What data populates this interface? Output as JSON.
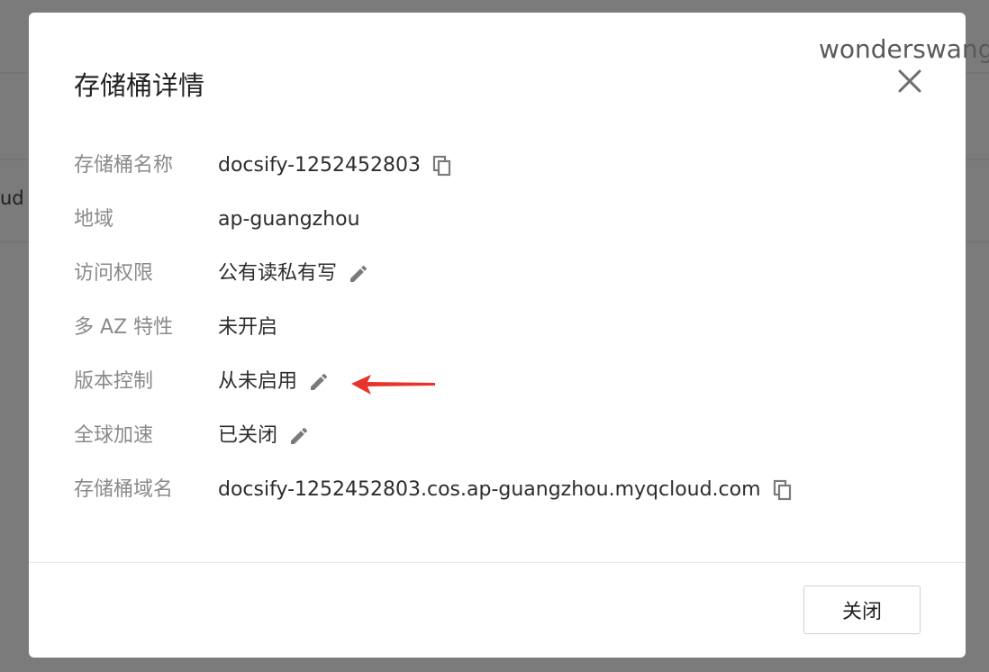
{
  "background": {
    "partial_text": "ud"
  },
  "watermark": "wonderswang",
  "dialog": {
    "title": "存储桶详情",
    "close_label": "关闭",
    "rows": [
      {
        "label": "存储桶名称",
        "value": "docsify-1252452803",
        "action": "copy-icon"
      },
      {
        "label": "地域",
        "value": "ap-guangzhou",
        "action": ""
      },
      {
        "label": "访问权限",
        "value": "公有读私有写",
        "action": "edit-icon"
      },
      {
        "label": "多 AZ 特性",
        "value": "未开启",
        "action": ""
      },
      {
        "label": "版本控制",
        "value": "从未启用",
        "action": "edit-icon"
      },
      {
        "label": "全球加速",
        "value": "已关闭",
        "action": "edit-icon"
      },
      {
        "label": "存储桶域名",
        "value": "docsify-1252452803.cos.ap-guangzhou.myqcloud.com",
        "action": "copy-icon"
      }
    ]
  },
  "colors": {
    "overlay": "#7b7b7b",
    "label": "#8a8a8a",
    "value": "#2d2d2d",
    "icon": "#7a7a7a",
    "annotation_arrow": "#e8322a"
  }
}
